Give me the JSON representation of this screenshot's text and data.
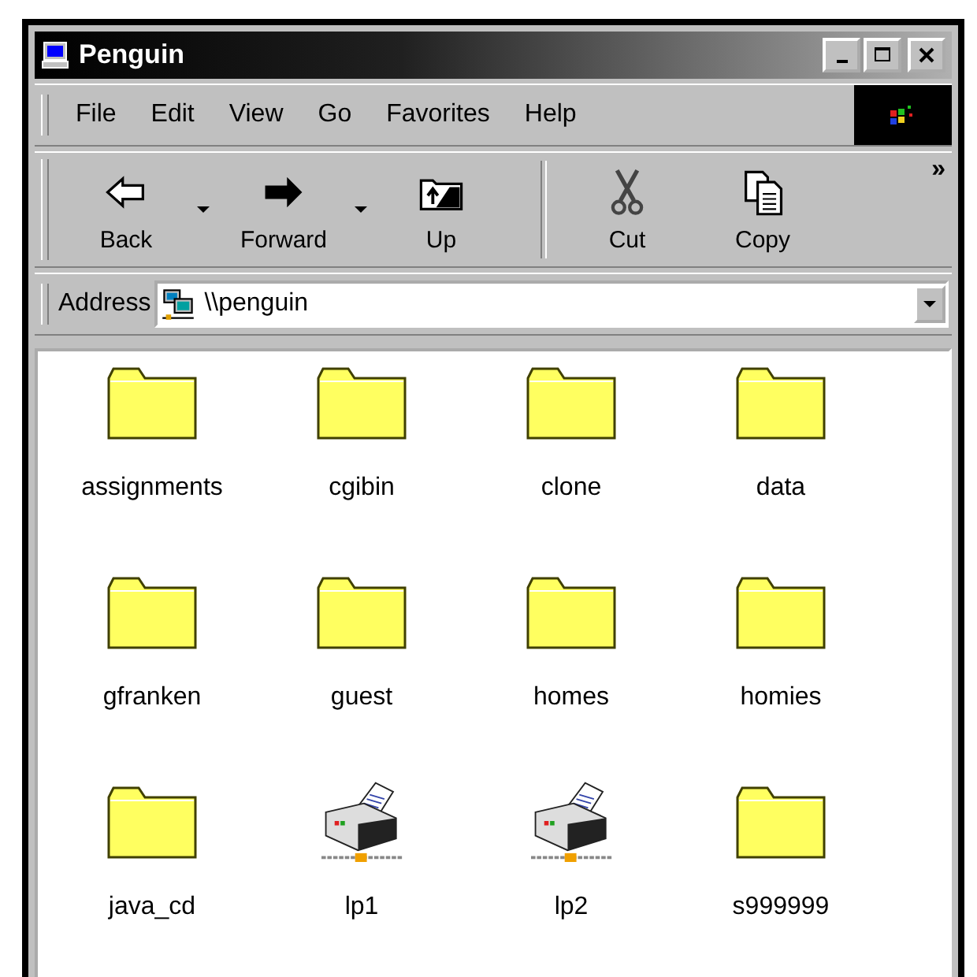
{
  "window": {
    "title": "Penguin"
  },
  "menu": [
    "File",
    "Edit",
    "View",
    "Go",
    "Favorites",
    "Help"
  ],
  "toolbar": {
    "buttons": [
      {
        "label": "Back",
        "kind": "back",
        "dropdown": true
      },
      {
        "label": "Forward",
        "kind": "forward",
        "dropdown": true
      },
      {
        "label": "Up",
        "kind": "up",
        "dropdown": false
      },
      {
        "label": "Cut",
        "kind": "cut",
        "dropdown": false
      },
      {
        "label": "Copy",
        "kind": "copy",
        "dropdown": false
      }
    ],
    "overflow": "»"
  },
  "address": {
    "label": "Address",
    "value": "\\\\penguin"
  },
  "items": [
    {
      "name": "assignments",
      "kind": "folder"
    },
    {
      "name": "cgibin",
      "kind": "folder"
    },
    {
      "name": "clone",
      "kind": "folder"
    },
    {
      "name": "data",
      "kind": "folder"
    },
    {
      "name": "gfranken",
      "kind": "folder"
    },
    {
      "name": "guest",
      "kind": "folder"
    },
    {
      "name": "homes",
      "kind": "folder"
    },
    {
      "name": "homies",
      "kind": "folder"
    },
    {
      "name": "java_cd",
      "kind": "folder"
    },
    {
      "name": "lp1",
      "kind": "printer"
    },
    {
      "name": "lp2",
      "kind": "printer"
    },
    {
      "name": "s999999",
      "kind": "folder"
    }
  ]
}
